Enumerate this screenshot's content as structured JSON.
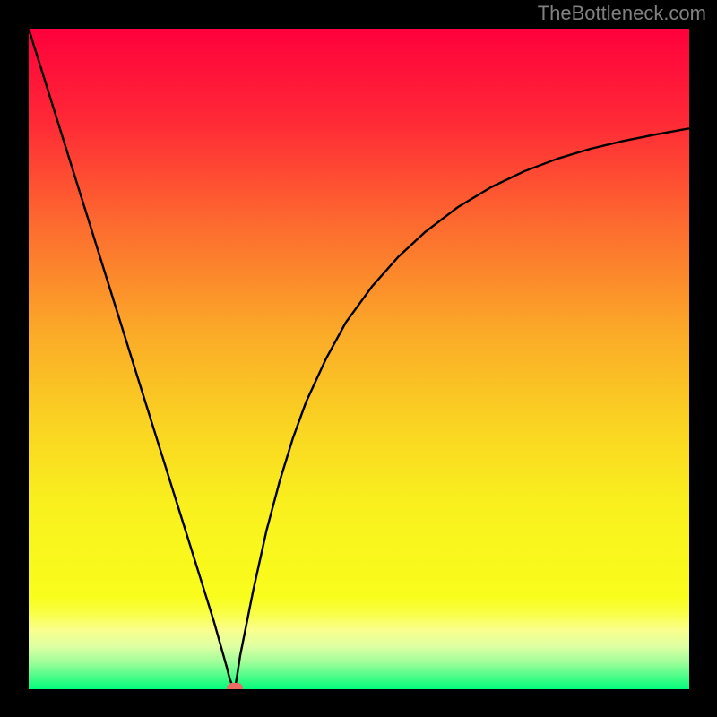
{
  "watermark": "TheBottleneck.com",
  "chart_data": {
    "type": "line",
    "title": "",
    "xlabel": "",
    "ylabel": "",
    "xlim": [
      0,
      100
    ],
    "ylim": [
      0,
      100
    ],
    "series": [
      {
        "name": "curve",
        "x": [
          0,
          2,
          4,
          6,
          8,
          10,
          12,
          14,
          16,
          18,
          20,
          22,
          24,
          26,
          28,
          30,
          30.4,
          30.8,
          31.0,
          31.3,
          31.5,
          32,
          34,
          36,
          38,
          40,
          42,
          45,
          48,
          52,
          56,
          60,
          65,
          70,
          75,
          80,
          85,
          90,
          95,
          100
        ],
        "y": [
          100,
          93.6,
          87.2,
          80.8,
          74.4,
          68,
          61.6,
          55.2,
          48.8,
          42.4,
          36,
          29.6,
          23.2,
          16.8,
          10.4,
          3.3,
          1.7,
          0.6,
          0.15,
          0.6,
          1.7,
          5,
          15,
          24,
          31.5,
          38,
          43.5,
          50,
          55.5,
          61,
          65.5,
          69.2,
          73,
          76,
          78.4,
          80.3,
          81.8,
          83,
          84,
          84.9
        ]
      }
    ],
    "gradient_stops": [
      {
        "pos": 0.0,
        "color": "#ff003c"
      },
      {
        "pos": 0.14,
        "color": "#ff2936"
      },
      {
        "pos": 0.3,
        "color": "#fd6c2f"
      },
      {
        "pos": 0.46,
        "color": "#fbaa28"
      },
      {
        "pos": 0.6,
        "color": "#fad422"
      },
      {
        "pos": 0.72,
        "color": "#f9f01e"
      },
      {
        "pos": 0.86,
        "color": "#f9fd1c"
      },
      {
        "pos": 0.885,
        "color": "#f9ff46"
      },
      {
        "pos": 0.91,
        "color": "#faff8c"
      },
      {
        "pos": 0.935,
        "color": "#deffa3"
      },
      {
        "pos": 0.96,
        "color": "#9dfe99"
      },
      {
        "pos": 0.985,
        "color": "#3bfc86"
      },
      {
        "pos": 1.0,
        "color": "#02fc7d"
      }
    ],
    "marker": {
      "x": 31.2,
      "y": 0.2
    }
  }
}
